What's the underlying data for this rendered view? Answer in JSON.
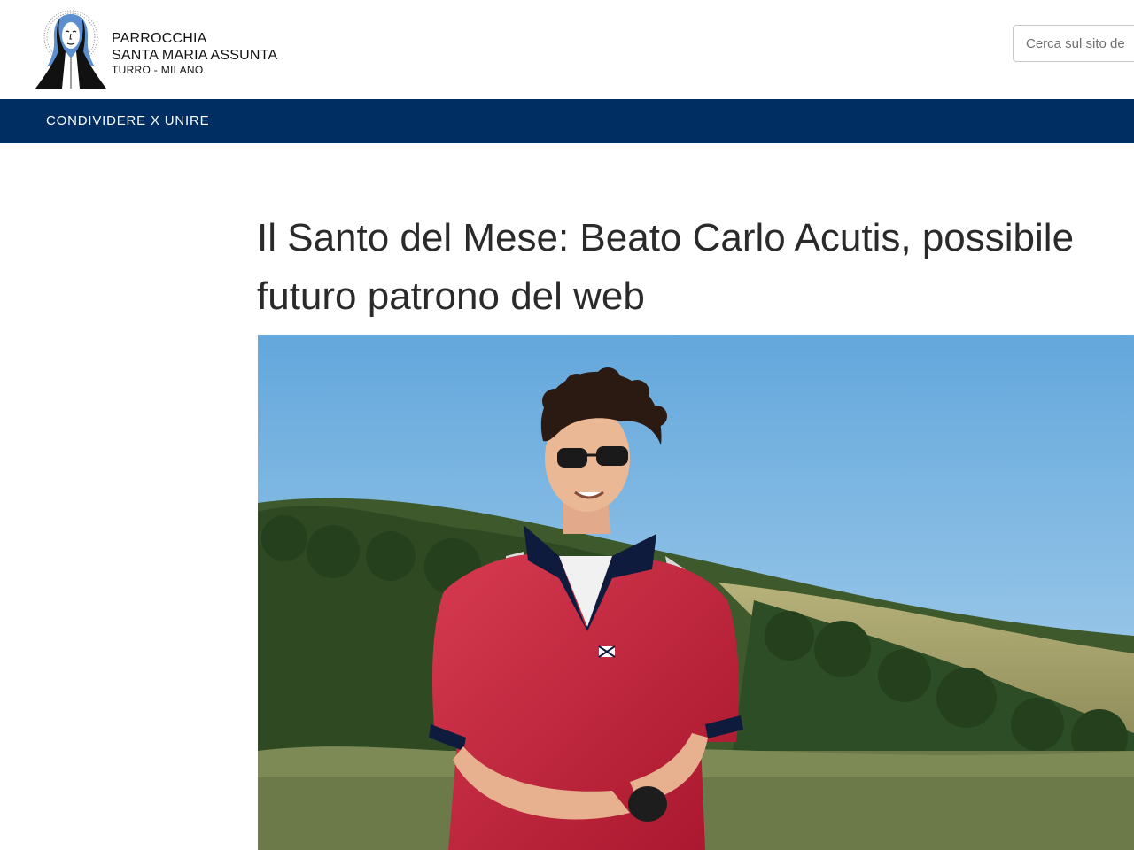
{
  "header": {
    "logo": {
      "line1": "PARROCCHIA",
      "line2": "SANTA MARIA ASSUNTA",
      "line3": "TURRO - MILANO"
    },
    "search": {
      "placeholder": "Cerca sul sito de"
    }
  },
  "nav": {
    "items": [
      {
        "label": "CONDIVIDERE X UNIRE"
      }
    ]
  },
  "article": {
    "title": "Il Santo del Mese: Beato Carlo Acutis, possibile futuro patrono del web"
  },
  "colors": {
    "nav_background": "#002d62",
    "nav_text": "#ffffff",
    "title_text": "#2a2a2a"
  },
  "icons": {
    "logo_mark": "madonna-halo-icon"
  }
}
